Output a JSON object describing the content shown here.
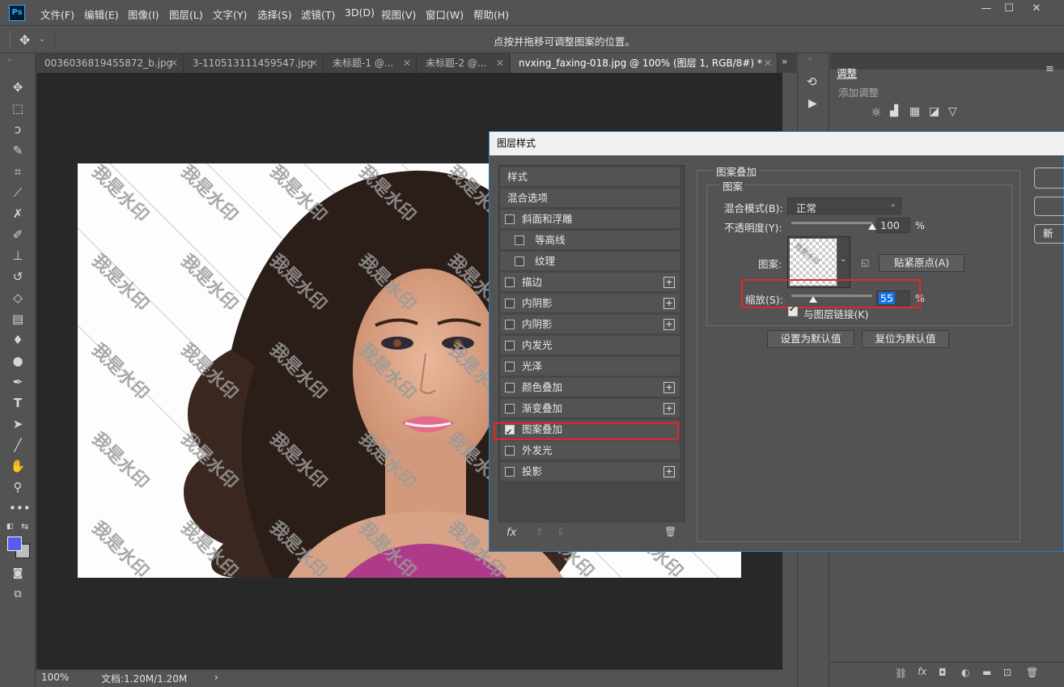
{
  "app": {
    "logo": "Ps"
  },
  "menu": [
    "文件(F)",
    "编辑(E)",
    "图像(I)",
    "图层(L)",
    "文字(Y)",
    "选择(S)",
    "滤镜(T)",
    "3D(D)",
    "视图(V)",
    "窗口(W)",
    "帮助(H)"
  ],
  "window_buttons": [
    "—",
    "☐",
    "✕"
  ],
  "options_bar": {
    "message": "点按并拖移可调整图案的位置。"
  },
  "tabs": [
    {
      "label": "0036036819455872_b.jpg",
      "close": "✕"
    },
    {
      "label": "3-110513111459547.jpg",
      "close": "✕"
    },
    {
      "label": "未标题-1 @...",
      "close": "✕"
    },
    {
      "label": "未标题-2 @...",
      "close": "✕"
    },
    {
      "label": "nvxing_faxing-018.jpg  @ 100% (图层 1, RGB/8#) *",
      "close": "✕"
    }
  ],
  "tab_overflow": "»",
  "canvas": {
    "watermark": "我是水印"
  },
  "status": {
    "zoom": "100%",
    "doc": "文档:1.20M/1.20M",
    "arrow": "›"
  },
  "adjust_panel": {
    "tab": "调整",
    "add": "添加调整"
  },
  "dialog": {
    "title": "图层样式",
    "styles": [
      {
        "label": "样式",
        "checkbox": false,
        "checked": false,
        "plus": false,
        "indent": 0
      },
      {
        "label": "混合选项",
        "checkbox": false,
        "checked": false,
        "plus": false,
        "indent": 0
      },
      {
        "label": "斜面和浮雕",
        "checkbox": true,
        "checked": false,
        "plus": false,
        "indent": 0
      },
      {
        "label": "等高线",
        "checkbox": true,
        "checked": false,
        "plus": false,
        "indent": 1
      },
      {
        "label": "纹理",
        "checkbox": true,
        "checked": false,
        "plus": false,
        "indent": 1
      },
      {
        "label": "描边",
        "checkbox": true,
        "checked": false,
        "plus": true,
        "indent": 0
      },
      {
        "label": "内阴影",
        "checkbox": true,
        "checked": false,
        "plus": true,
        "indent": 0
      },
      {
        "label": "内阴影",
        "checkbox": true,
        "checked": false,
        "plus": true,
        "indent": 0
      },
      {
        "label": "内发光",
        "checkbox": true,
        "checked": false,
        "plus": false,
        "indent": 0
      },
      {
        "label": "光泽",
        "checkbox": true,
        "checked": false,
        "plus": false,
        "indent": 0
      },
      {
        "label": "颜色叠加",
        "checkbox": true,
        "checked": false,
        "plus": true,
        "indent": 0
      },
      {
        "label": "渐变叠加",
        "checkbox": true,
        "checked": false,
        "plus": true,
        "indent": 0
      },
      {
        "label": "图案叠加",
        "checkbox": true,
        "checked": true,
        "plus": false,
        "indent": 0
      },
      {
        "label": "外发光",
        "checkbox": true,
        "checked": false,
        "plus": false,
        "indent": 0
      },
      {
        "label": "投影",
        "checkbox": true,
        "checked": false,
        "plus": true,
        "indent": 0
      }
    ],
    "footer": {
      "fx": "fx",
      "up": "⇧",
      "down": "⇩",
      "trash": "🗑"
    },
    "section_title": "图案叠加",
    "sub_title": "图案",
    "blend_label": "混合模式(B):",
    "blend_value": "正常",
    "opacity_label": "不透明度(Y):",
    "opacity_value": "100",
    "opacity_unit": "%",
    "opacity_level": 1.0,
    "pattern_label": "图案:",
    "snap_button": "贴紧原点(A)",
    "scale_label": "缩放(S):",
    "scale_value": "55",
    "scale_unit": "%",
    "scale_level": 0.27,
    "link_label": "与图层链接(K)",
    "link_checked": true,
    "default_set": "设置为默认值",
    "default_reset": "复位为默认值",
    "right_buttons": [
      "",
      "",
      "新"
    ]
  }
}
